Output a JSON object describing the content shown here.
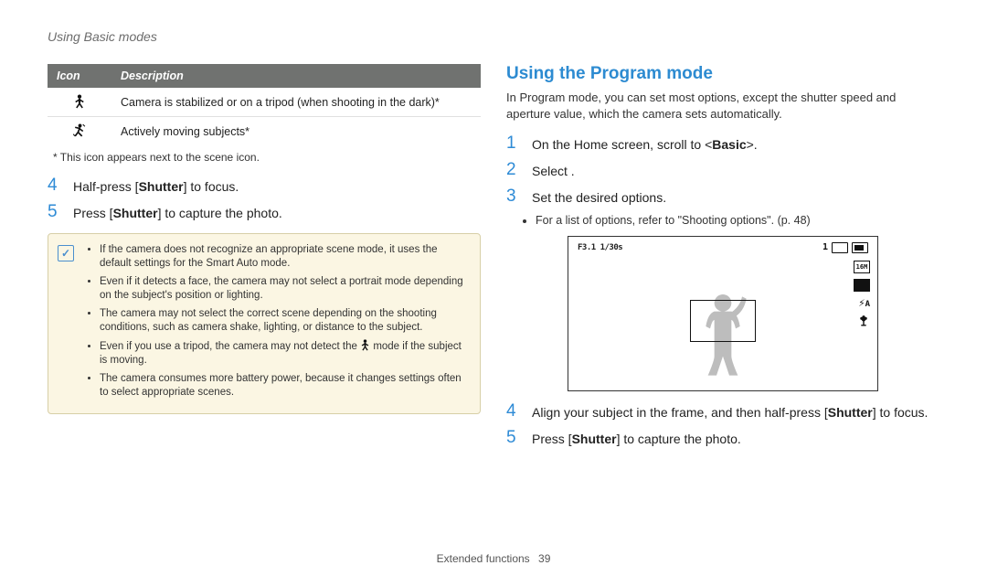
{
  "header": "Using Basic modes",
  "left": {
    "table": {
      "headers": [
        "Icon",
        "Description"
      ],
      "rows": [
        {
          "icon_name": "tripod-icon",
          "desc": "Camera is stabilized or on a tripod (when shooting in the dark)*"
        },
        {
          "icon_name": "moving-subject-icon",
          "desc": "Actively moving subjects*"
        }
      ]
    },
    "footnote": "* This icon appears next to the scene icon.",
    "steps": [
      {
        "num": "4",
        "html": "Half-press [<b>Shutter</b>] to focus."
      },
      {
        "num": "5",
        "html": "Press [<b>Shutter</b>] to capture the photo."
      }
    ],
    "note_items": [
      "If the camera does not recognize an appropriate scene mode, it uses the default settings for the Smart Auto mode.",
      "Even if it detects a face, the camera may not select a portrait mode depending on the subject's position or lighting.",
      "The camera may not select the correct scene depending on the shooting conditions, such as camera shake, lighting, or distance to the subject.",
      "Even if you use a tripod, the camera may not detect the  mode if the subject is moving.",
      "The camera consumes more battery power, because it changes settings often to select appropriate scenes."
    ],
    "note_inline_icon_index": 3
  },
  "right": {
    "heading": "Using the Program mode",
    "intro": "In Program mode, you can set most options, except the shutter speed and aperture value, which the camera sets automatically.",
    "steps": [
      {
        "num": "1",
        "html": "On the Home screen, scroll to &lt;<b>Basic</b>&gt;."
      },
      {
        "num": "2",
        "html": "Select        ."
      },
      {
        "num": "3",
        "html": "Set the desired options."
      },
      {
        "num": "4",
        "html": "Align your subject in the frame, and then half-press [<b>Shutter</b>] to focus."
      },
      {
        "num": "5",
        "html": "Press [<b>Shutter</b>] to capture the photo."
      }
    ],
    "step3_sub": "For a list of options, refer to \"Shooting options\". (p. 48)",
    "preview": {
      "top_left": "F3.1 1/30s",
      "count": "1",
      "size_badge": "16M",
      "af_label": "A"
    }
  },
  "footer": {
    "section": "Extended functions",
    "page": "39"
  }
}
